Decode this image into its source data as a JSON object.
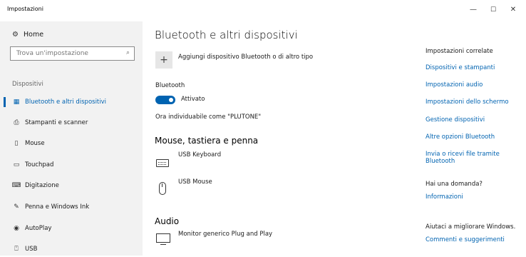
{
  "window": {
    "title": "Impostazioni",
    "minimize": "—",
    "maximize": "☐",
    "close": "✕"
  },
  "sidebar": {
    "home": {
      "label": "Home",
      "icon": "gear-icon"
    },
    "search": {
      "placeholder": "Trova un'impostazione",
      "icon": "search-icon"
    },
    "section": "Dispositivi",
    "items": [
      {
        "label": "Bluetooth e altri dispositivi",
        "icon": "bluetooth-devices-icon",
        "active": true
      },
      {
        "label": "Stampanti e scanner",
        "icon": "printer-icon"
      },
      {
        "label": "Mouse",
        "icon": "mouse-icon"
      },
      {
        "label": "Touchpad",
        "icon": "touchpad-icon"
      },
      {
        "label": "Digitazione",
        "icon": "keyboard-icon"
      },
      {
        "label": "Penna e Windows Ink",
        "icon": "pen-icon"
      },
      {
        "label": "AutoPlay",
        "icon": "autoplay-icon"
      },
      {
        "label": "USB",
        "icon": "usb-icon"
      }
    ]
  },
  "main": {
    "title": "Bluetooth e altri dispositivi",
    "add_device": "Aggiungi dispositivo Bluetooth o di altro tipo",
    "bluetooth": {
      "label": "Bluetooth",
      "state": "Attivato",
      "on": true
    },
    "discoverable": "Ora individuabile come \"PLUTONE\"",
    "sections": [
      {
        "title": "Mouse, tastiera e penna",
        "devices": [
          "USB Keyboard",
          "USB Mouse"
        ]
      },
      {
        "title": "Audio",
        "devices": [
          "Monitor generico Plug and Play"
        ]
      }
    ]
  },
  "right": {
    "related_title": "Impostazioni correlate",
    "related_links": [
      "Dispositivi e stampanti",
      "Impostazioni audio",
      "Impostazioni dello schermo",
      "Gestione dispositivi",
      "Altre opzioni Bluetooth",
      "Invia o ricevi file tramite Bluetooth"
    ],
    "question_title": "Hai una domanda?",
    "question_link": "Informazioni",
    "improve_title": "Aiutaci a migliorare Windows.",
    "improve_link": "Commenti e suggerimenti"
  },
  "colors": {
    "accent": "#0063b1",
    "sidebar_bg": "#f2f2f2"
  }
}
